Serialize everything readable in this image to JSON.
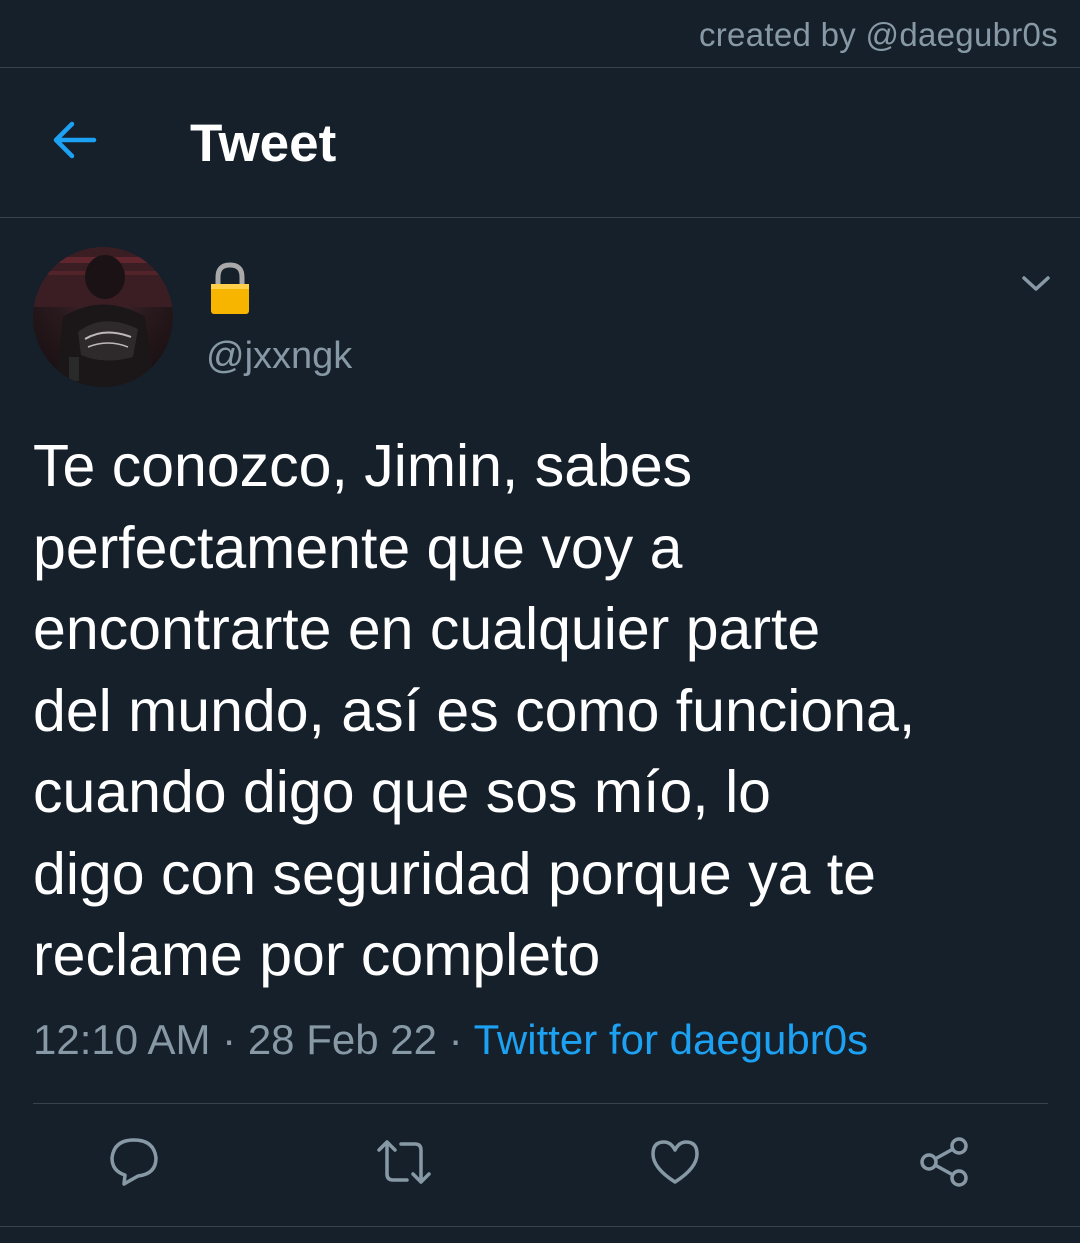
{
  "credit": "created by @daegubr0s",
  "header": {
    "title": "Tweet",
    "back_icon": "arrow-left-icon"
  },
  "author": {
    "handle": "@jxxngk",
    "protected_icon": "lock-icon"
  },
  "tweet": {
    "text": "Te conozco, Jimin, sabes\nperfectamente que voy a\nencontrarte en cualquier parte\ndel mundo, así es como funciona,\ncuando digo que sos mío, lo\ndigo con seguridad porque ya te\nreclame por completo",
    "time": "12:10 AM",
    "separator": "·",
    "date": "28 Feb 22",
    "source": "Twitter for daegubr0s"
  },
  "actions": [
    "reply-icon",
    "retweet-icon",
    "like-icon",
    "share-icon"
  ],
  "colors": {
    "background": "#15202b",
    "accent": "#1da1f2",
    "muted_text": "#8899a6",
    "divider": "#38444d"
  }
}
